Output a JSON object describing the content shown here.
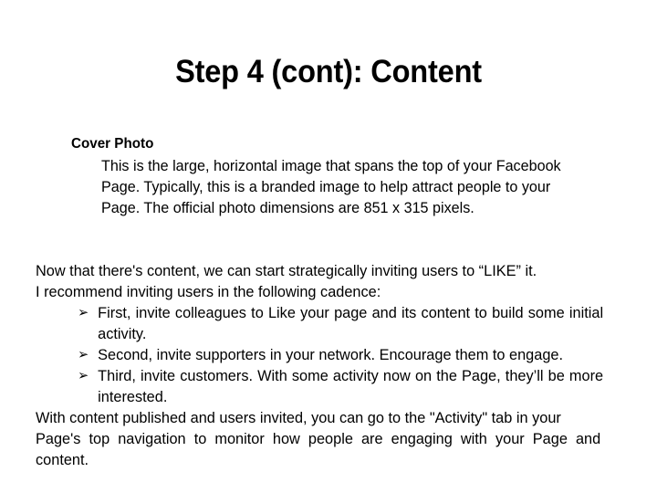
{
  "slide": {
    "title": "Step 4 (cont): Content",
    "sections": {
      "cover_photo": {
        "heading": "Cover Photo",
        "body": "This is the large, horizontal image that spans the top of your Facebook Page. Typically, this is a branded image to help attract people to your Page. The official photo dimensions are 851 x 315 pixels."
      },
      "invite": {
        "intro_line_1": "Now that there's content, we can start strategically inviting users to “LIKE” it.",
        "intro_line_2": "I recommend inviting users in the following cadence:",
        "bullet_glyph": "➢",
        "bullets": [
          "First, invite colleagues to Like your page and its content to build some initial activity.",
          "Second, invite supporters in your network. Encourage them to engage.",
          "Third, invite customers. With some activity now on the Page, they’ll be more interested."
        ]
      },
      "closing": {
        "text_part_1": "With content published and users invited, you can go to the \"Activity\" tab in your ",
        "text_part_2": "Page's top navigation to monitor how people are engaging with your Page and content."
      }
    }
  }
}
